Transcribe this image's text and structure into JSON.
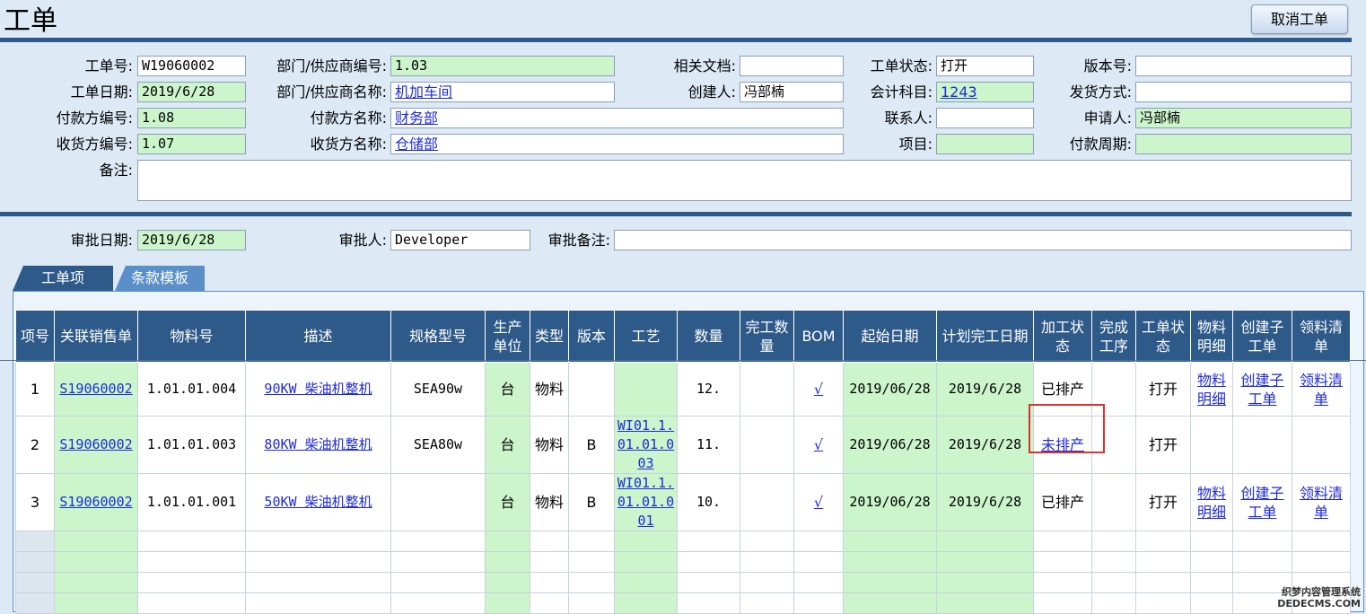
{
  "header": {
    "title": "工单",
    "cancel_button": "取消工单"
  },
  "form": {
    "order_no": {
      "label": "工单号:",
      "value": "W19060002"
    },
    "order_date": {
      "label": "工单日期:",
      "value": "2019/6/28"
    },
    "payer_no": {
      "label": "付款方编号:",
      "value": "1.08"
    },
    "receiver_no": {
      "label": "收货方编号:",
      "value": "1.07"
    },
    "remark": {
      "label": "备注:",
      "value": ""
    },
    "dept_no": {
      "label": "部门/供应商编号:",
      "value": "1.03"
    },
    "dept_name": {
      "label": "部门/供应商名称:",
      "value": "机加车间"
    },
    "payer_name": {
      "label": "付款方名称:",
      "value": "财务部"
    },
    "receiver_name": {
      "label": "收货方名称:",
      "value": "仓储部"
    },
    "docs": {
      "label": "相关文档:",
      "value": ""
    },
    "creator": {
      "label": "创建人:",
      "value": "冯部楠"
    },
    "contact": {
      "label": "联系人:",
      "value": ""
    },
    "project": {
      "label": "项目:",
      "value": ""
    },
    "status": {
      "label": "工单状态:",
      "value": "打开"
    },
    "account": {
      "label": "会计科目:",
      "value": "1243"
    },
    "version": {
      "label": "版本号:",
      "value": ""
    },
    "ship_method": {
      "label": "发货方式:",
      "value": ""
    },
    "applicant": {
      "label": "申请人:",
      "value": "冯部楠"
    },
    "pay_period": {
      "label": "付款周期:",
      "value": ""
    }
  },
  "approval": {
    "date": {
      "label": "审批日期:",
      "value": "2019/6/28"
    },
    "approver": {
      "label": "审批人:",
      "value": "Developer"
    },
    "note": {
      "label": "审批备注:",
      "value": ""
    }
  },
  "tabs": [
    {
      "label": "工单项"
    },
    {
      "label": "条款模板"
    }
  ],
  "table": {
    "columns": [
      "项号",
      "关联销售单",
      "物料号",
      "描述",
      "规格型号",
      "生产单位",
      "类型",
      "版本",
      "工艺",
      "数量",
      "完工数量",
      "BOM",
      "起始日期",
      "计划完工日期",
      "加工状态",
      "完成工序",
      "工单状态",
      "物料明细",
      "创建子工单",
      "领料清单"
    ],
    "rows": [
      {
        "no": "1",
        "so": "S19060002",
        "item": "1.01.01.004",
        "desc": "90KW 柴油机整机",
        "spec": "SEA90w",
        "unit": "台",
        "type": "物料",
        "ver": "",
        "route": "",
        "qty": "12.",
        "done": "",
        "bom": "√",
        "start": "2019/06/28",
        "plan": "2019/6/28",
        "proc": "已排产",
        "step": "",
        "state": "打开",
        "detail": "物料明细",
        "sub": "创建子工单",
        "pick": "领料清单"
      },
      {
        "no": "2",
        "so": "S19060002",
        "item": "1.01.01.003",
        "desc": "80KW 柴油机整机",
        "spec": "SEA80w",
        "unit": "台",
        "type": "物料",
        "ver": "B",
        "route": "WI01.1.01.01.003",
        "qty": "11.",
        "done": "",
        "bom": "√",
        "start": "2019/06/28",
        "plan": "2019/6/28",
        "proc": "未排产",
        "step": "",
        "state": "打开",
        "detail": "",
        "sub": "",
        "pick": ""
      },
      {
        "no": "3",
        "so": "S19060002",
        "item": "1.01.01.001",
        "desc": "50KW 柴油机整机",
        "spec": "",
        "unit": "台",
        "type": "物料",
        "ver": "B",
        "route": "WI01.1.01.01.001",
        "qty": "10.",
        "done": "",
        "bom": "√",
        "start": "2019/06/28",
        "plan": "2019/6/28",
        "proc": "已排产",
        "step": "",
        "state": "打开",
        "detail": "物料明细",
        "sub": "创建子工单",
        "pick": "领料清单"
      }
    ]
  },
  "watermark": {
    "line1": "织梦内容管理系统",
    "line2": "DEDECMS.COM"
  }
}
